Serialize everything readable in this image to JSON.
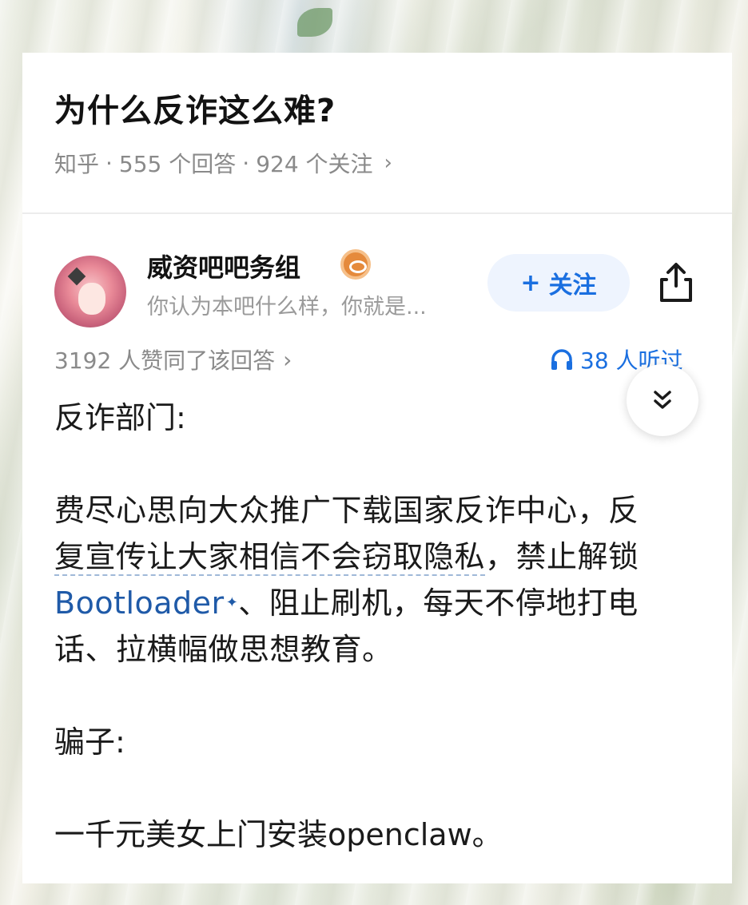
{
  "question": {
    "title": "为什么反诈这么难?",
    "meta_source": "知乎",
    "meta_answers": "555 个回答",
    "meta_followers": "924 个关注",
    "meta_sep": "·",
    "meta_chevron": "›"
  },
  "author": {
    "name": "威资吧吧务组",
    "bio": "你认为本吧什么样，你就是...",
    "follow_plus": "+",
    "follow_label": "关注",
    "badge_icon": "eye-badge-icon",
    "share_icon": "share-icon"
  },
  "stats": {
    "likes": "3192 人赞同了该回答",
    "likes_chevron": "›",
    "listeners": "38 人听过",
    "listen_icon": "headphones-icon"
  },
  "expand_icon": "double-chevron-down-icon",
  "answer": {
    "p1": "反诈部门:",
    "p2_a": "费尽心思向大众推广下载国家反诈中心，反",
    "p2_b_underlined": "复宣传让大家相信不会窃取隐私",
    "p2_b_rest": "，禁止解锁",
    "p2_link": "Bootloader",
    "p2_link_mark": "✦",
    "p2_c": "、阻止刷机，每天不停地打电",
    "p2_d": "话、拉横幅做思想教育。",
    "p3": "骗子:",
    "p4": "一千元美女上门安装openclaw。"
  },
  "colors": {
    "accent_blue": "#1a6fe0",
    "follow_bg": "#eef4fe",
    "link_blue": "#1f5aa8",
    "meta_gray": "#8a8a8a",
    "title_black": "#121212"
  }
}
